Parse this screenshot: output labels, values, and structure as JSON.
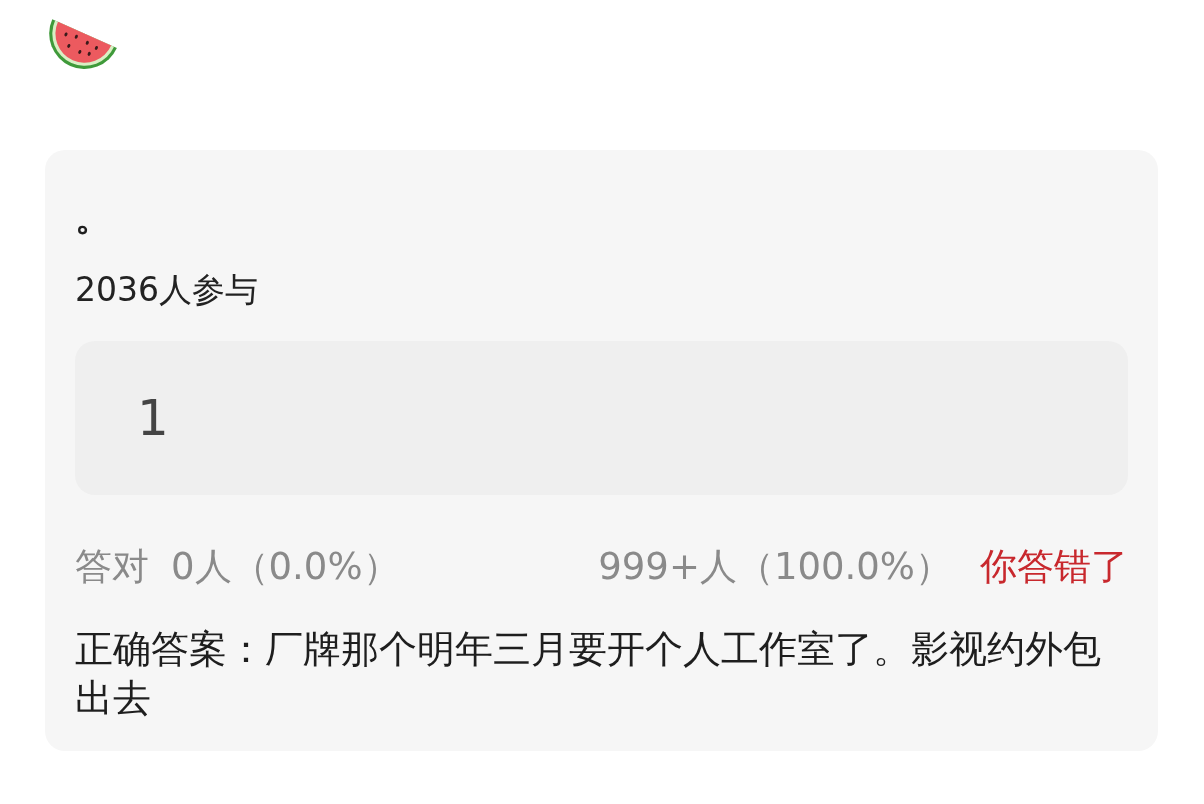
{
  "question": {
    "title": "。",
    "participants": "2036人参与",
    "answer_box": {
      "value": "1"
    }
  },
  "stats": {
    "correct_label": "答对",
    "correct_count": "0人（0.0%）",
    "others_count": "999+人（100.0%）",
    "result": {
      "text": "你答错了",
      "correct": false
    }
  },
  "correct_answer": "正确答案：厂牌那个明年三月要开个人工作室了。影视约外包出去"
}
